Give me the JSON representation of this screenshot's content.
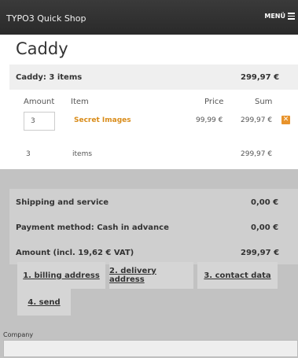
{
  "header": {
    "brand": "TYPO3 Quick Shop",
    "menu_label": "MENÜ"
  },
  "page_title": "Caddy",
  "caddy": {
    "summary_label": "Caddy: 3 items",
    "summary_total": "299,97 €"
  },
  "columns": {
    "amount": "Amount",
    "item": "Item",
    "price": "Price",
    "sum": "Sum"
  },
  "items": [
    {
      "quantity": "3",
      "name": "Secret Images",
      "price": "99,99 €",
      "sum": "299,97 €"
    }
  ],
  "totals_line": {
    "count": "3",
    "label": "items",
    "total": "299,97 €"
  },
  "details": [
    {
      "label": "Shipping and service",
      "value": "0,00 €"
    },
    {
      "label": "Payment method: Cash in advance",
      "value": "0,00 €"
    },
    {
      "label": "Amount (incl. 19,62 € VAT)",
      "value": "299,97 €"
    }
  ],
  "steps": [
    "1. billing address",
    "2. delivery address",
    "3. contact data",
    "4. send"
  ],
  "form": {
    "company_label": "Company",
    "company_value": ""
  }
}
